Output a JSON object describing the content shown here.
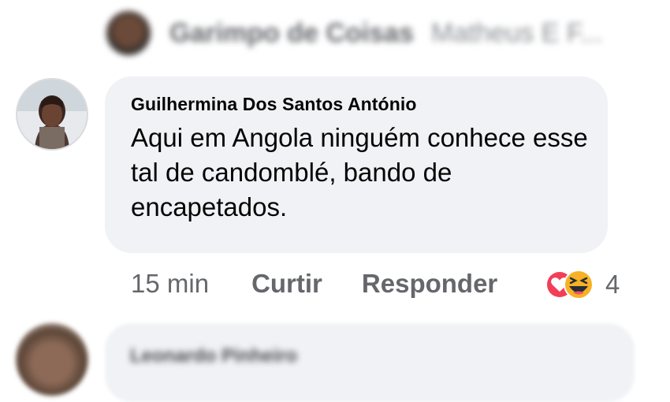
{
  "previous_comment": {
    "author": "Garimpo de Coisas",
    "reply_to": "Matheus E F..."
  },
  "comment": {
    "author": "Guilhermina Dos Santos António",
    "text": "Aqui em Angola ninguém conhece esse tal de candomblé, bando de encapetados.",
    "time": "15 min",
    "like_label": "Curtir",
    "reply_label": "Responder",
    "reaction_icons": [
      "love-reaction-icon",
      "haha-reaction-icon"
    ],
    "reaction_count": "4"
  },
  "next_comment": {
    "author": "Leonardo Pinheiro"
  },
  "colors": {
    "bubble": "#f0f2f5",
    "secondary_text": "#65676b",
    "love": "#f33e58",
    "haha": "#f7b125"
  }
}
